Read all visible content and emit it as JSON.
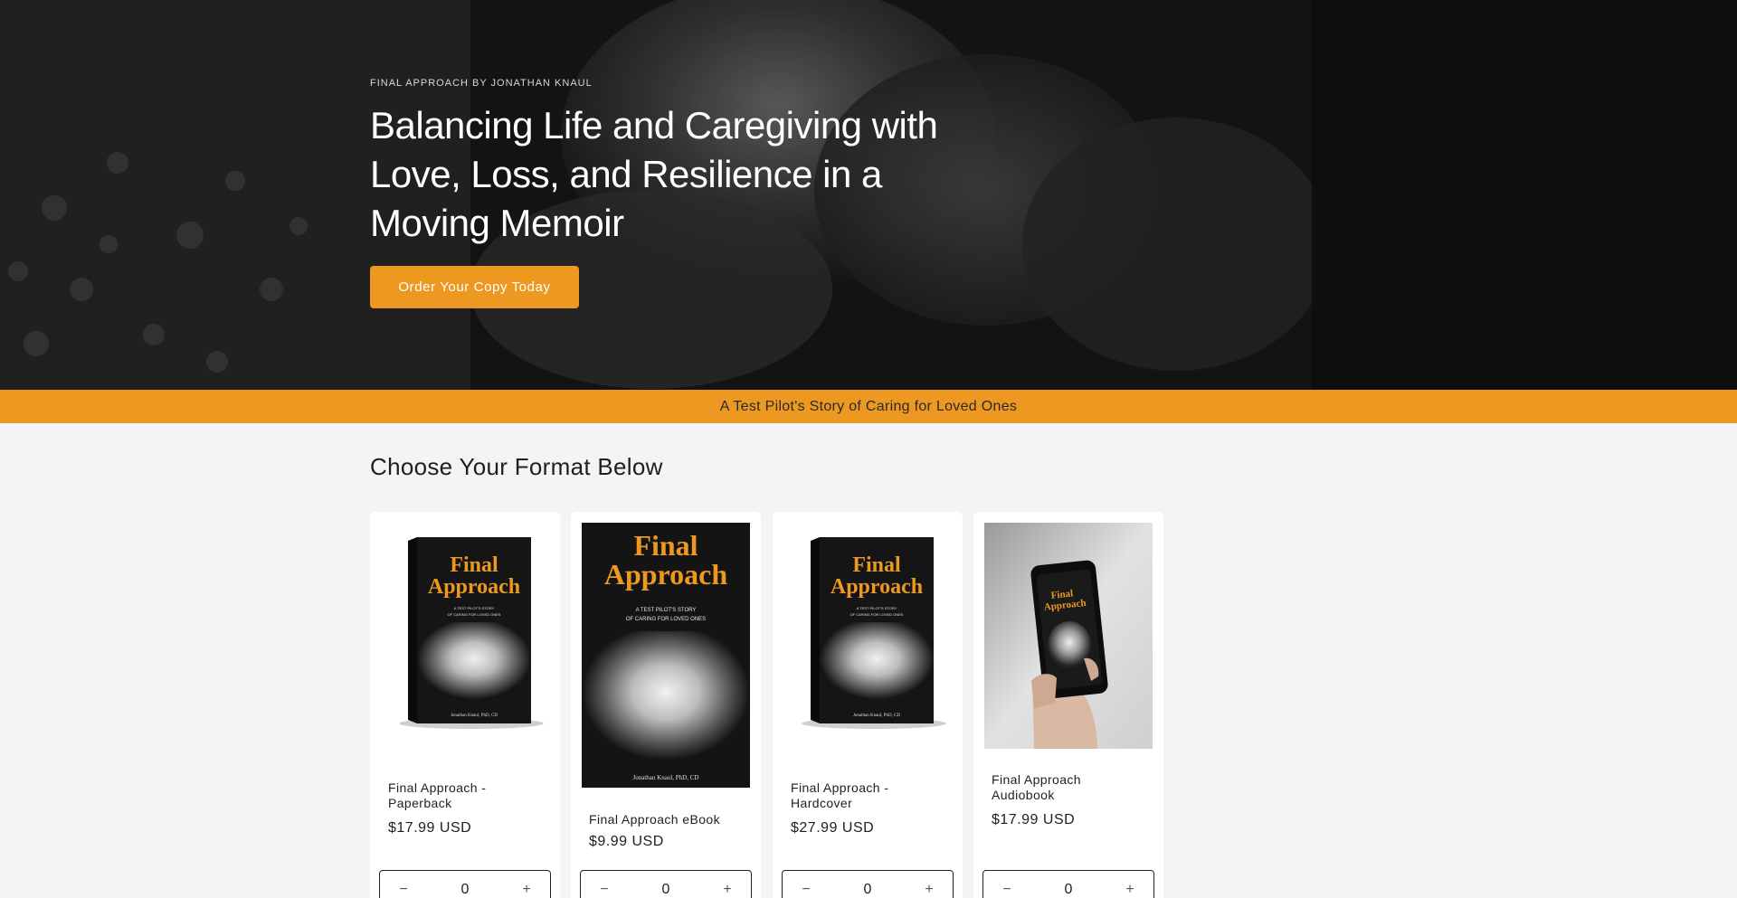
{
  "hero": {
    "eyebrow": "FINAL APPROACH BY JONATHAN KNAUL",
    "title": "Balancing Life and Caregiving with Love, Loss, and Resilience in a Moving Memoir",
    "cta_label": "Order Your Copy Today"
  },
  "announcement": {
    "text": "A Test Pilot's Story of Caring for Loved Ones"
  },
  "products_section": {
    "title": "Choose Your Format Below",
    "products": [
      {
        "name": "Final Approach - Paperback",
        "price": "$17.99 USD",
        "quantity": "0",
        "image_icon": "book-3d-cover"
      },
      {
        "name": "Final Approach eBook",
        "price": "$9.99 USD",
        "quantity": "0",
        "image_icon": "ebook-flat-cover"
      },
      {
        "name": "Final Approach - Hardcover",
        "price": "$27.99 USD",
        "quantity": "0",
        "image_icon": "book-3d-cover"
      },
      {
        "name": "Final Approach Audiobook",
        "price": "$17.99 USD",
        "quantity": "0",
        "image_icon": "phone-in-hand"
      }
    ],
    "cover_art": {
      "title_line1": "Final",
      "title_line2": "Approach",
      "subtitle_line1": "A TEST PILOT'S STORY",
      "subtitle_line2": "OF CARING FOR LOVED ONES",
      "author": "Jonathan Knaul, PhD, CD"
    },
    "decrement_symbol": "−",
    "increment_symbol": "+"
  },
  "colors": {
    "accent": "#ec9821",
    "background": "#f4f4f4",
    "card": "#ffffff",
    "text": "#1f1f1f"
  }
}
